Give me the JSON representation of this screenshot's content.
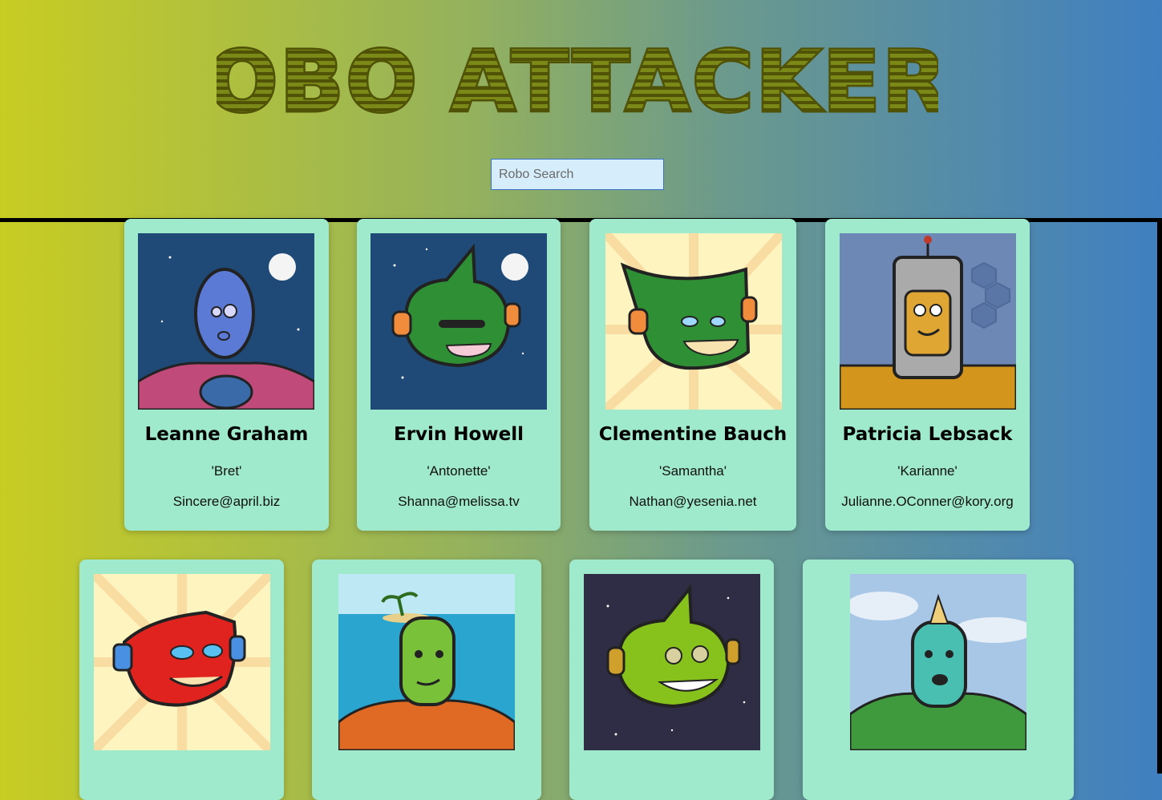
{
  "header": {
    "title": "ROBO ATTACKERS",
    "search_placeholder": "Robo Search"
  },
  "colors": {
    "title_fill": "#4f5207",
    "card_bg": "#9fe9cd",
    "search_bg": "#d6edfb"
  },
  "robots": [
    {
      "name": "Leanne Graham",
      "username": "'Bret'",
      "email": "Sincere@april.biz"
    },
    {
      "name": "Ervin Howell",
      "username": "'Antonette'",
      "email": "Shanna@melissa.tv"
    },
    {
      "name": "Clementine Bauch",
      "username": "'Samantha'",
      "email": "Nathan@yesenia.net"
    },
    {
      "name": "Patricia Lebsack",
      "username": "'Karianne'",
      "email": "Julianne.OConner@kory.org"
    },
    {
      "name": "",
      "username": "",
      "email": ""
    },
    {
      "name": "",
      "username": "",
      "email": ""
    },
    {
      "name": "",
      "username": "",
      "email": ""
    },
    {
      "name": "",
      "username": "",
      "email": ""
    }
  ]
}
